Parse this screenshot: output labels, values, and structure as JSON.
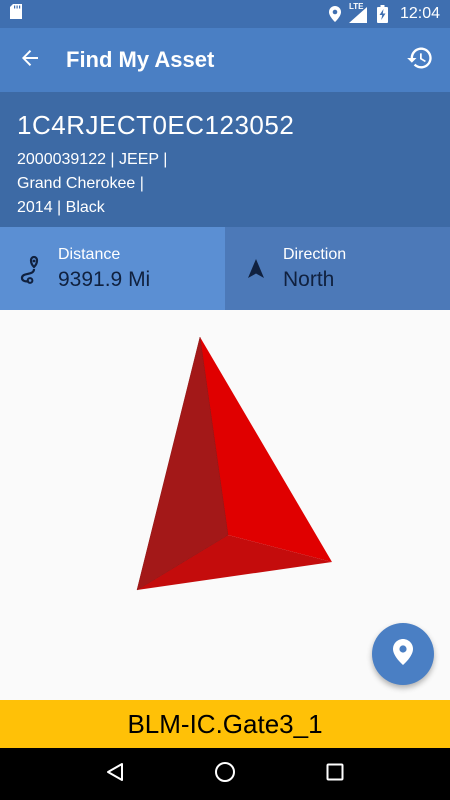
{
  "status_bar": {
    "time": "12:04",
    "network_label": "LTE",
    "icons": [
      "sd-card-icon",
      "location-icon",
      "lte-signal-icon",
      "battery-charging-icon"
    ]
  },
  "app_bar": {
    "title": "Find My Asset",
    "back_icon": "arrow-back-icon",
    "history_icon": "history-icon"
  },
  "vehicle": {
    "vin": "1C4RJECT0EC123052",
    "details": [
      "2000039122 | JEEP |",
      "Grand Cherokee |",
      "2014 | Black"
    ]
  },
  "distance": {
    "label": "Distance",
    "value": "9391.9 Mi",
    "icon": "route-icon"
  },
  "direction": {
    "label": "Direction",
    "value": "North",
    "icon": "navigation-arrow-icon"
  },
  "compass": {
    "icon": "compass-arrow-icon",
    "colors": {
      "light": "#e00000",
      "dark": "#a31818",
      "mid": "#c40c0c"
    }
  },
  "fab": {
    "icon": "map-pin-icon",
    "color": "#4a7fc4"
  },
  "location_bar": {
    "text": "BLM-IC.Gate3_1",
    "color": "#ffc107"
  },
  "nav_bar": {
    "icons": [
      "back-triangle-icon",
      "home-circle-icon",
      "recents-square-icon"
    ]
  },
  "colors": {
    "status_bar": "#3f6fb0",
    "app_bar": "#4a7fc4",
    "vehicle_header": "#3d6aa5",
    "distance_bg": "#5b8fd3",
    "direction_bg": "#4c79b8"
  }
}
